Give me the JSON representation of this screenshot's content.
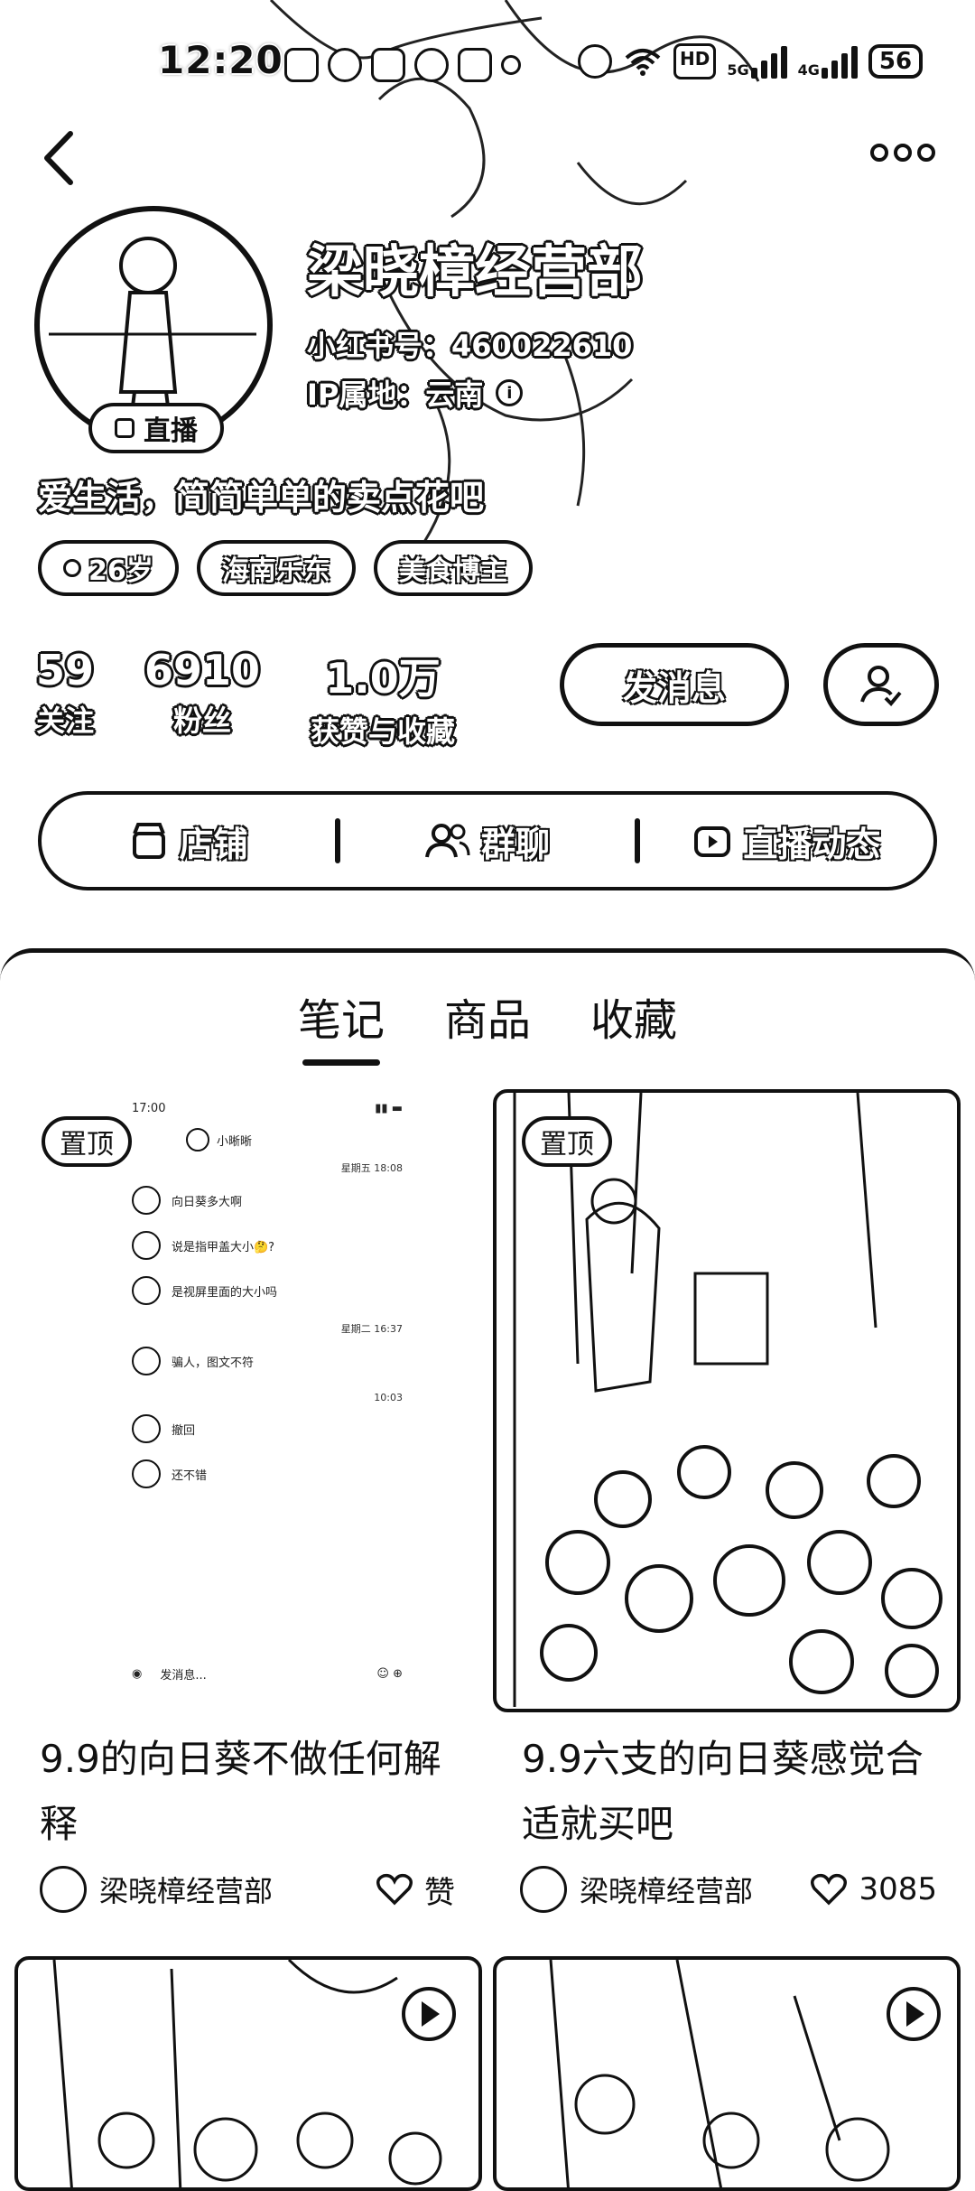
{
  "status_bar": {
    "time": "12:20",
    "battery": "56",
    "network_a": "5G",
    "network_b": "4G",
    "hd": "HD"
  },
  "profile": {
    "name": "梁晓樟经营部",
    "red_id": "小红书号：460022610",
    "ip_location": "IP属地：云南",
    "live_label": "直播",
    "bio": "爱生活，简简单单的卖点花吧",
    "tags": [
      "26岁",
      "海南乐东",
      "美食博主"
    ]
  },
  "stats": [
    {
      "num": "59",
      "label": "关注"
    },
    {
      "num": "6910",
      "label": "粉丝"
    },
    {
      "num": "1.0万",
      "label": "获赞与收藏"
    }
  ],
  "actions": {
    "message": "发消息"
  },
  "shortcuts": [
    "店铺",
    "群聊",
    "直播动态"
  ],
  "tabs": [
    "笔记",
    "商品",
    "收藏"
  ],
  "cards": [
    {
      "pin": "置顶",
      "title": "9.9的向日葵不做任何解释",
      "author": "梁晓樟经营部",
      "likes": "赞",
      "chat": {
        "time": "17:00",
        "contact": "小晰晰",
        "date1": "星期五 18:08",
        "msgs1": [
          "向日葵多大啊",
          "说是指甲盖大小🤔?",
          "是视屏里面的大小吗"
        ],
        "date2": "星期二 16:37",
        "msgs2": [
          "骗人，图文不符"
        ],
        "date3": "10:03",
        "msgs3": [
          "撤回",
          "还不错"
        ],
        "input": "发消息..."
      }
    },
    {
      "pin": "置顶",
      "title": "9.9六支的向日葵感觉合适就买吧",
      "author": "梁晓樟经营部",
      "likes": "3085"
    }
  ]
}
